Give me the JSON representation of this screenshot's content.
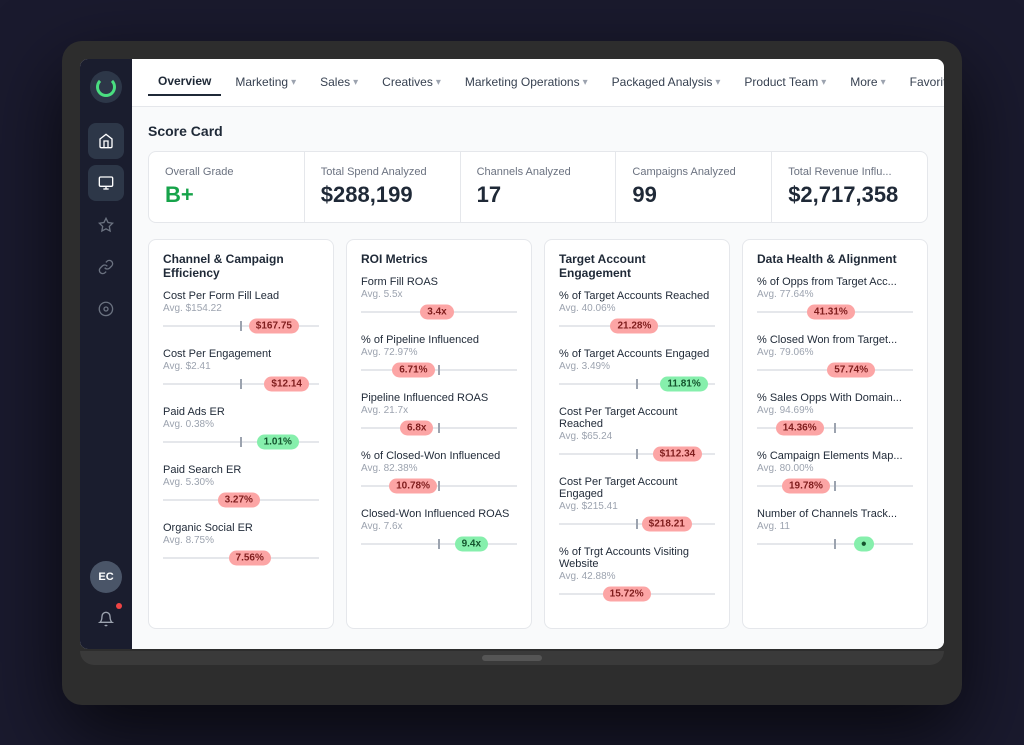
{
  "app": {
    "logo_label": "App Logo"
  },
  "nav": {
    "items": [
      {
        "label": "Overview",
        "active": true,
        "has_chevron": false
      },
      {
        "label": "Marketing",
        "active": false,
        "has_chevron": true
      },
      {
        "label": "Sales",
        "active": false,
        "has_chevron": true
      },
      {
        "label": "Creatives",
        "active": false,
        "has_chevron": true
      },
      {
        "label": "Marketing Operations",
        "active": false,
        "has_chevron": true
      },
      {
        "label": "Packaged Analysis",
        "active": false,
        "has_chevron": true
      },
      {
        "label": "Product Team",
        "active": false,
        "has_chevron": true
      },
      {
        "label": "More",
        "active": false,
        "has_chevron": true
      },
      {
        "label": "Favorites",
        "active": false,
        "has_chevron": true
      }
    ]
  },
  "scorecard": {
    "title": "Score Card",
    "metrics": [
      {
        "label": "Overall Grade",
        "value": "B+",
        "color": "green"
      },
      {
        "label": "Total Spend Analyzed",
        "value": "$288,199",
        "color": "normal"
      },
      {
        "label": "Channels Analyzed",
        "value": "17",
        "color": "normal"
      },
      {
        "label": "Campaigns Analyzed",
        "value": "99",
        "color": "normal"
      },
      {
        "label": "Total Revenue Influ...",
        "value": "$2,717,358",
        "color": "normal"
      }
    ]
  },
  "panels": [
    {
      "title": "Channel & Campaign Efficiency",
      "rows": [
        {
          "label": "Cost Per Form Fill Lead",
          "avg": "Avg. $154.22",
          "value": "$167.75",
          "type": "red",
          "position": 55
        },
        {
          "label": "Cost Per Engagement",
          "avg": "Avg. $2.41",
          "value": "$12.14",
          "type": "red",
          "position": 65
        },
        {
          "label": "Paid Ads ER",
          "avg": "Avg. 0.38%",
          "value": "1.01%",
          "type": "green",
          "position": 60
        },
        {
          "label": "Paid Search ER",
          "avg": "Avg. 5.30%",
          "value": "3.27%",
          "type": "red",
          "position": 35
        },
        {
          "label": "Organic Social ER",
          "avg": "Avg. 8.75%",
          "value": "7.56%",
          "type": "red",
          "position": 42
        }
      ]
    },
    {
      "title": "ROI Metrics",
      "rows": [
        {
          "label": "Form Fill ROAS",
          "avg": "Avg. 5.5x",
          "value": "3.4x",
          "type": "red",
          "position": 38
        },
        {
          "label": "% of Pipeline Influenced",
          "avg": "Avg. 72.97%",
          "value": "6.71%",
          "type": "red",
          "position": 20
        },
        {
          "label": "Pipeline Influenced ROAS",
          "avg": "Avg. 21.7x",
          "value": "6.8x",
          "type": "red",
          "position": 25
        },
        {
          "label": "% of Closed-Won Influenced",
          "avg": "Avg. 82.38%",
          "value": "10.78%",
          "type": "red",
          "position": 18
        },
        {
          "label": "Closed-Won Influenced ROAS",
          "avg": "Avg. 7.6x",
          "value": "9.4x",
          "type": "green",
          "position": 60
        }
      ]
    },
    {
      "title": "Target Account Engagement",
      "rows": [
        {
          "label": "% of Target Accounts Reached",
          "avg": "Avg. 40.06%",
          "value": "21.28%",
          "type": "red",
          "position": 33
        },
        {
          "label": "% of Target Accounts Engaged",
          "avg": "Avg. 3.49%",
          "value": "11.81%",
          "type": "green",
          "position": 65
        },
        {
          "label": "Cost Per Target Account Reached",
          "avg": "Avg. $65.24",
          "value": "$112.34",
          "type": "red",
          "position": 60
        },
        {
          "label": "Cost Per Target Account Engaged",
          "avg": "Avg. $215.41",
          "value": "$218.21",
          "type": "red",
          "position": 53
        },
        {
          "label": "% of Trgt Accounts Visiting Website",
          "avg": "Avg. 42.88%",
          "value": "15.72%",
          "type": "red",
          "position": 28
        }
      ]
    },
    {
      "title": "Data Health & Alignment",
      "rows": [
        {
          "label": "% of Opps from Target Acc...",
          "avg": "Avg. 77.64%",
          "value": "41.31%",
          "type": "red",
          "position": 32
        },
        {
          "label": "% Closed Won from Target...",
          "avg": "Avg. 79.06%",
          "value": "57.74%",
          "type": "red",
          "position": 45
        },
        {
          "label": "% Sales Opps With Domain...",
          "avg": "Avg. 94.69%",
          "value": "14.36%",
          "type": "red",
          "position": 12
        },
        {
          "label": "% Campaign Elements Map...",
          "avg": "Avg. 80.00%",
          "value": "19.78%",
          "type": "red",
          "position": 16
        },
        {
          "label": "Number of Channels Track...",
          "avg": "Avg. 11",
          "value": "●",
          "type": "green",
          "position": 62
        }
      ]
    }
  ],
  "sidebar": {
    "nav_icons": [
      "home",
      "chart",
      "sparkle",
      "link",
      "settings"
    ],
    "bottom": {
      "avatar": "EC",
      "notifications": true
    }
  }
}
